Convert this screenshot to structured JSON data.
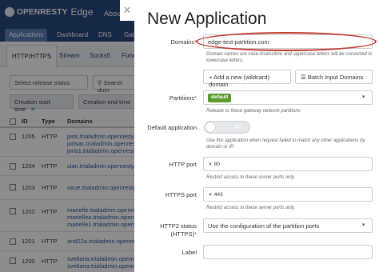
{
  "app": {
    "logo_text": "OPENRESTY",
    "logo_edge": "Edge",
    "top_about": "About"
  },
  "nav": {
    "tabs": [
      "Applications",
      "Dashboard",
      "DNS",
      "Gat"
    ]
  },
  "subnav": {
    "tabs": [
      "HTTP/HTTPS",
      "Stream",
      "Socks5",
      "Forw"
    ]
  },
  "filters": {
    "release_status": "Select release status",
    "search_placeholder": "Search dom",
    "chip_start": "Creation start time",
    "chip_end": "Creation end time",
    "chip_close": "✕"
  },
  "table": {
    "headers": [
      "ID",
      "Type",
      "Domains"
    ],
    "rows": [
      {
        "id": "1205",
        "type": "HTTP",
        "domains": [
          "joris.trialadmin.openresty.c",
          "jorisac.trialadmin.openresty",
          "joris1.trialadmin.openresty"
        ]
      },
      {
        "id": "1204",
        "type": "HTTP",
        "domains": [
          "cian.trialadmin.openresty.co"
        ]
      },
      {
        "id": "1203",
        "type": "HTTP",
        "domains": [
          "uxue.trialadmin.openresty.c"
        ]
      },
      {
        "id": "1202",
        "type": "HTTP",
        "domains": [
          "marielle.trialadmin.openrest",
          "mariellea.trialadmin.openres",
          "marielle1.trialadmin.openres"
        ]
      },
      {
        "id": "1201",
        "type": "HTTP",
        "domains": [
          "and22a.trialadmin.openresty"
        ]
      },
      {
        "id": "1200",
        "type": "HTTP",
        "domains": [
          "svetlana.trialadmin.openres",
          "svetlana.trialadmin.openres"
        ]
      }
    ]
  },
  "modal": {
    "close": "✕",
    "title": "New Application",
    "domains": {
      "label": "Domains",
      "required": "*",
      "value": "edge-test-partition.com",
      "help": "Domain names are case-insensitive and uppercase letters will be converted to lowercase letters.",
      "add_wildcard": "+ Add a new (wildcard) domain",
      "batch_input": "Batch Input Domains"
    },
    "partitions": {
      "label": "Partitions",
      "required": "*",
      "selected": "default",
      "help": "Release to these gateway network partitions"
    },
    "default_application": {
      "label": "Default application",
      "toggle_text": "NO",
      "help": "Use this application when request failed to match any other applications by domain or IP."
    },
    "http_port": {
      "label": "HTTP port",
      "tag_x": "×",
      "value": "80",
      "help": "Restrict access to these server ports only."
    },
    "https_port": {
      "label": "HTTPS port",
      "tag_x": "×",
      "value": "443",
      "help": "Restrict access to these server ports only."
    },
    "http2_status": {
      "label_line1": "HTTP2 status",
      "label_line2": "(HTTPS)",
      "required": "*",
      "value": "Use the configuration of the partition ports"
    },
    "label_field": {
      "label": "Label",
      "value": ""
    }
  },
  "icons": {
    "close": "close-icon",
    "caret": "caret-down-icon",
    "search": "search-icon"
  }
}
